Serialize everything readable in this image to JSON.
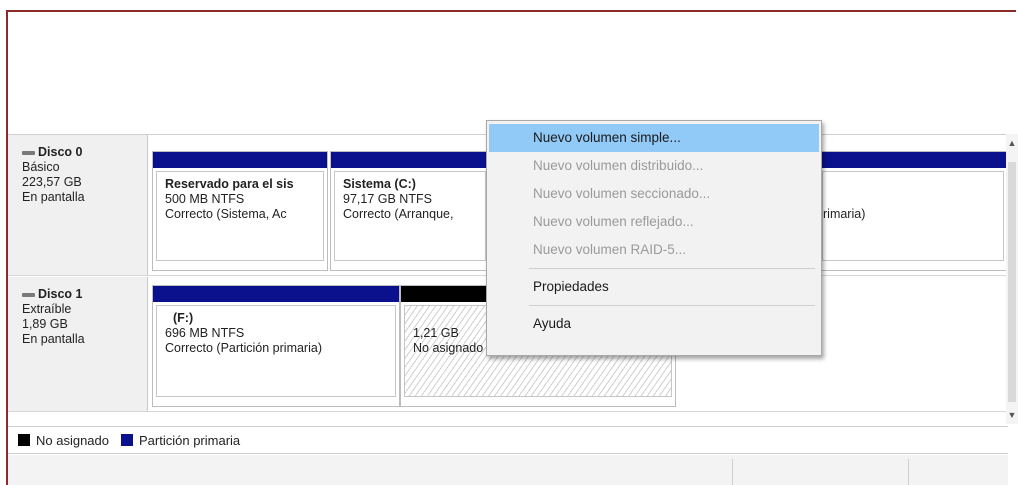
{
  "disks": [
    {
      "name": "Disco 0",
      "type": "Básico",
      "size": "223,57 GB",
      "status": "En pantalla",
      "partitions": [
        {
          "title": "Reservado para el sis",
          "size": "500 MB NTFS",
          "status": "Correcto (Sistema, Ac"
        },
        {
          "title": "Sistema  (C:)",
          "size": "97,17 GB NTFS",
          "status": "Correcto (Arranque,"
        },
        {
          "status_tail": "rimaria)"
        }
      ]
    },
    {
      "name": "Disco 1",
      "type": "Extraíble",
      "size": "1,89 GB",
      "status": "En pantalla",
      "partitions": [
        {
          "title": "(F:)",
          "size": "696 MB NTFS",
          "status": "Correcto (Partición primaria)"
        },
        {
          "size": "1,21 GB",
          "status": "No asignado"
        }
      ]
    }
  ],
  "legend": {
    "unallocated": "No asignado",
    "primary": "Partición primaria",
    "unallocated_color": "#000000",
    "primary_color": "#0b118c"
  },
  "context_menu": {
    "items": [
      {
        "label": "Nuevo volumen simple...",
        "state": "selected"
      },
      {
        "label": "Nuevo volumen distribuido...",
        "state": "disabled"
      },
      {
        "label": "Nuevo volumen seccionado...",
        "state": "disabled"
      },
      {
        "label": "Nuevo volumen reflejado...",
        "state": "disabled"
      },
      {
        "label": "Nuevo volumen RAID-5...",
        "state": "disabled"
      },
      {
        "label": "Propiedades",
        "state": "enabled"
      },
      {
        "label": "Ayuda",
        "state": "enabled"
      }
    ]
  },
  "scrollbar": {
    "up_icon": "chevron-up-icon",
    "down_icon": "chevron-down-icon"
  }
}
